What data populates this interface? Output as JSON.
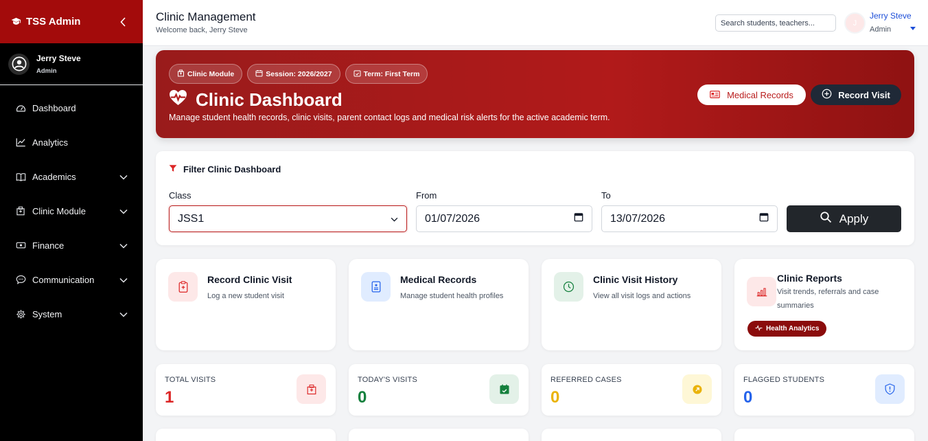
{
  "sidebar": {
    "brand": "TSS Admin",
    "user_name": "Jerry Steve",
    "user_role": "Admin",
    "items": [
      {
        "label": "Dashboard",
        "icon": "gauge-icon"
      },
      {
        "label": "Analytics",
        "icon": "chart-line-icon"
      },
      {
        "label": "Academics",
        "icon": "book-icon"
      },
      {
        "label": "Clinic Module",
        "icon": "hospital-icon"
      },
      {
        "label": "Finance",
        "icon": "money-icon"
      },
      {
        "label": "Communication",
        "icon": "chat-icon"
      },
      {
        "label": "System",
        "icon": "gear-icon"
      }
    ]
  },
  "header": {
    "title": "Clinic Management",
    "subtitle": "Welcome back, Jerry Steve",
    "search_placeholder": "Search students, teachers...",
    "avatar_initial": "J",
    "user_name": "Jerry Steve",
    "user_role": "Admin"
  },
  "hero": {
    "chips": [
      "Clinic Module",
      "Session: 2026/2027",
      "Term: First Term"
    ],
    "title": "Clinic Dashboard",
    "description": "Manage student health records, clinic visits, parent contact logs and medical risk alerts for the active academic term.",
    "btn_records": "Medical Records",
    "btn_record_visit": "Record Visit"
  },
  "filter": {
    "title": "Filter Clinic Dashboard",
    "class_label": "Class",
    "class_value": "JSS1",
    "from_label": "From",
    "from_value": "01/07/2026",
    "to_label": "To",
    "to_value": "13/07/2026",
    "apply_label": "Apply"
  },
  "actions": [
    {
      "title": "Record Clinic Visit",
      "desc": "Log a new student visit"
    },
    {
      "title": "Medical Records",
      "desc": "Manage student health profiles"
    },
    {
      "title": "Clinic Visit History",
      "desc": "View all visit logs and actions"
    },
    {
      "title": "Clinic Reports",
      "desc": "Visit trends, referrals and case summaries",
      "badge": "Health Analytics"
    }
  ],
  "stats": [
    {
      "label": "Total Visits",
      "value": "1",
      "color": "#dc2626"
    },
    {
      "label": "Today's Visits",
      "value": "0",
      "color": "#15803d"
    },
    {
      "label": "Referred Cases",
      "value": "0",
      "color": "#eab308"
    },
    {
      "label": "Flagged Students",
      "value": "0",
      "color": "#2563eb"
    }
  ],
  "colors": {
    "brand_red": "#a30b0b",
    "accent_red": "#b91c1c",
    "dark": "#1f2937"
  }
}
